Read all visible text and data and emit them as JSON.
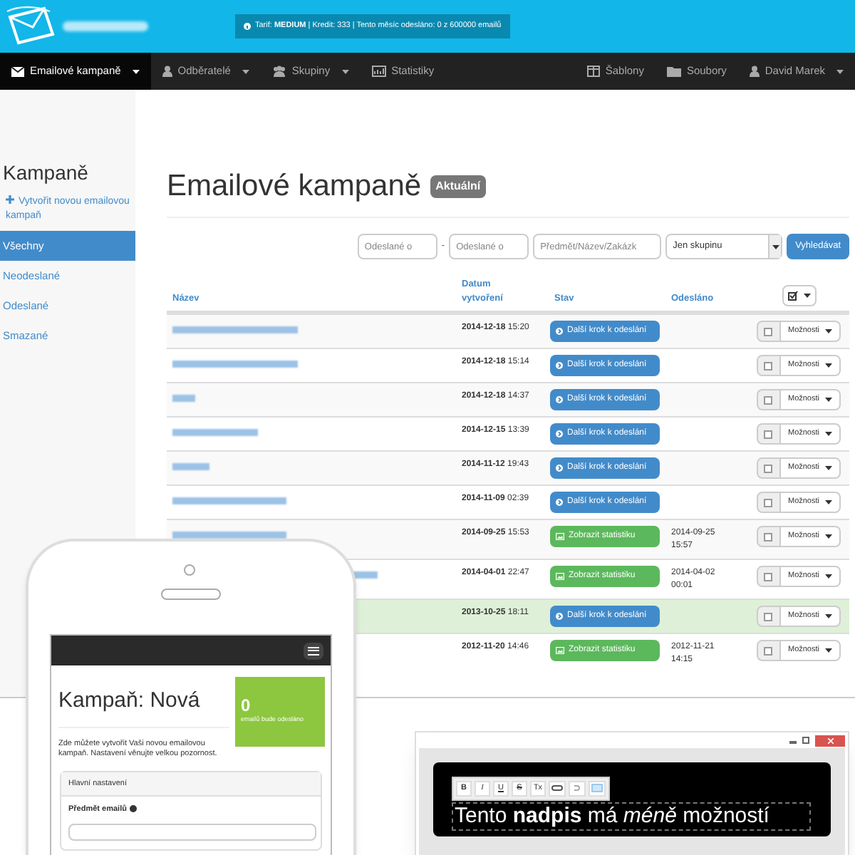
{
  "header": {
    "info": "Tarif: **MEDIUM** | Kredit: 333 | Tento měsíc odesláno: 0 z 600000 emailů"
  },
  "nav": {
    "left": [
      {
        "label": "Emailové kampaně",
        "selected": true,
        "dropdown": true
      },
      {
        "label": "Odběratelé",
        "selected": false,
        "dropdown": true
      },
      {
        "label": "Skupiny",
        "selected": false,
        "dropdown": true
      },
      {
        "label": "Statistiky",
        "selected": false,
        "dropdown": false
      }
    ],
    "right": [
      {
        "label": "Šablony",
        "selected": false,
        "dropdown": false
      },
      {
        "label": "Soubory",
        "selected": false,
        "dropdown": false
      },
      {
        "label": "David Marek",
        "selected": false,
        "dropdown": true
      }
    ]
  },
  "sidebar": {
    "title": "Kampaně",
    "create_link": "Vytvořit novou emailovou kampaň",
    "items": [
      {
        "label": "Všechny",
        "selected": true
      },
      {
        "label": "Neodeslané",
        "selected": false
      },
      {
        "label": "Odeslané",
        "selected": false
      },
      {
        "label": "Smazané",
        "selected": false
      }
    ]
  },
  "main": {
    "title": "Emailové kampaně",
    "badge": "Aktuální",
    "filters": {
      "from_placeholder": "Odeslané o",
      "separator": "-",
      "to_placeholder": "Odeslané o",
      "text_placeholder": "Předmět/Název/Zakázk",
      "group_select": "Jen skupinu",
      "search_button": "Vyhledávat"
    },
    "table": {
      "columns": [
        "Název",
        "Datum vytvoření",
        "Stav",
        "Odesláno"
      ],
      "rows": [
        {
          "created": "**2014-12-18** 15:20",
          "status": {
            "kind": "next",
            "label": "Další krok k odeslání"
          },
          "highlighted": false,
          "checked": false,
          "options": "Možnosti"
        },
        {
          "created": "**2014-12-18** 15:14",
          "status": {
            "kind": "next",
            "label": "Další krok k odeslání"
          },
          "highlighted": false,
          "checked": false,
          "options": "Možnosti"
        },
        {
          "created": "**2014-12-18** 14:37",
          "status": {
            "kind": "next",
            "label": "Další krok k odeslání"
          },
          "highlighted": false,
          "checked": false,
          "options": "Možnosti"
        },
        {
          "created": "**2014-12-15** 13:39",
          "status": {
            "kind": "next",
            "label": "Další krok k odeslání"
          },
          "highlighted": false,
          "checked": false,
          "options": "Možnosti"
        },
        {
          "created": "**2014-11-12** 19:43",
          "status": {
            "kind": "next",
            "label": "Další krok k odeslání"
          },
          "highlighted": false,
          "checked": false,
          "options": "Možnosti"
        },
        {
          "created": "**2014-11-09** 02:39",
          "status": {
            "kind": "next",
            "label": "Další krok k odeslání"
          },
          "highlighted": false,
          "checked": false,
          "options": "Možnosti"
        },
        {
          "created": "**2014-09-25** 15:53",
          "status": {
            "kind": "stats",
            "label": "Zobrazit statistiku"
          },
          "sent": "2014-09-25 15:57",
          "highlighted": false,
          "checked": false,
          "options": "Možnosti"
        },
        {
          "created": "**2014-04-01** 22:47",
          "status": {
            "kind": "stats",
            "label": "Zobrazit statistiku"
          },
          "sent": "2014-04-02 00:01",
          "highlighted": false,
          "checked": false,
          "options": "Možnosti"
        },
        {
          "created": "**2013-10-25** 18:11",
          "status": {
            "kind": "next",
            "label": "Další krok k odeslání"
          },
          "highlighted": true,
          "checked": false,
          "options": "Možnosti"
        },
        {
          "created": "**2012-11-20** 14:46",
          "status": {
            "kind": "stats",
            "label": "Zobrazit statistiku"
          },
          "sent": "2012-11-21 14:15",
          "highlighted": false,
          "checked": false,
          "options": "Možnosti"
        }
      ]
    }
  },
  "phone": {
    "title": "Kampaň: Nová",
    "counter": "0",
    "counter_label": "emailů bude odesláno",
    "intro": "Zde můžete vytvořit Vaši novou emailovou kampaň. Nastavení věnujte velkou pozornost.",
    "panel_title": "Hlavní nastavení",
    "field_label": "Předmět emailů"
  },
  "editor": {
    "toolbar": [
      {
        "kind": "text",
        "label": "B"
      },
      {
        "kind": "text",
        "label": "I"
      },
      {
        "kind": "text",
        "label": "U"
      },
      {
        "kind": "text",
        "label": "S"
      },
      {
        "kind": "text",
        "label": "Tx"
      },
      {
        "kind": "link"
      },
      {
        "kind": "unlink"
      },
      {
        "kind": "image"
      }
    ],
    "heading": "Tento **nadpis** má *méně* možností"
  }
}
